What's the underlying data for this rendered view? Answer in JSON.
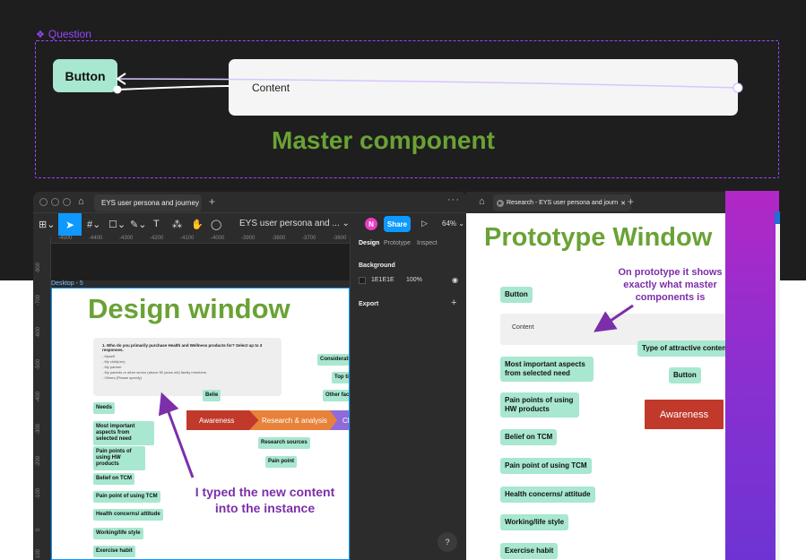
{
  "master": {
    "question_label": "Question",
    "button_label": "Button",
    "content_label": "Content",
    "title": "Master component"
  },
  "design_window": {
    "tab_title": "EYS user persona and journey",
    "file_name": "EYS user persona and ...",
    "avatar_initial": "N",
    "share_label": "Share",
    "zoom": "64%",
    "ruler_ticks": [
      "-4500",
      "-4400",
      "-4300",
      "-4200",
      "-4100",
      "-4000",
      "-3900",
      "-3800",
      "-3700",
      "-3600"
    ],
    "ruler_vticks": [
      "-800",
      "-700",
      "-600",
      "-500",
      "-400",
      "-300",
      "-200",
      "-100",
      "0",
      "100"
    ],
    "frame_label": "Desktop - 5",
    "title": "Design window",
    "question_card": {
      "title": "1. Who do you primarily purchase Health and Wellness products for? Select up to 3 responses.",
      "options": [
        "- Myself",
        "- My child(ren)",
        "- My partner",
        "- My parents or other senior (above 50 years old) family members",
        "- Others (Please specify)"
      ]
    },
    "chips_left": [
      "Needs",
      "Most important aspects from selected need",
      "Pain points of using HW products",
      "Belief on TCM",
      "Pain point of using TCM",
      "Health concerns/ attitude",
      "Working/life style",
      "Exercise habit"
    ],
    "chips_right": [
      "Consideration",
      "Top tier",
      "Other facto",
      "Belie"
    ],
    "journey": [
      "Awareness",
      "Research & analysis",
      "Cho"
    ],
    "chip_research_sources": "Research sources",
    "chip_pain_point": "Pain point",
    "annotation": "I typed the new content into the instance",
    "panel": {
      "tabs": [
        "Design",
        "Prototype",
        "Inspect"
      ],
      "background_heading": "Background",
      "bg_hex": "1E1E1E",
      "bg_opacity": "100%",
      "export_heading": "Export"
    }
  },
  "prototype_window": {
    "tab_title": "Research - EYS user persona and journ",
    "title": "Prototype Window",
    "annotation": "On prototype it shows exactly what master components is",
    "button_label": "Button",
    "content_label": "Content",
    "chips": [
      "Most important aspects from selected need",
      "Pain points of using HW products",
      "Belief on TCM",
      "Pain point of using TCM",
      "Health concerns/ attitude",
      "Working/life style",
      "Exercise habit"
    ],
    "chip_attractive": "Type of attractive conten",
    "button_right": "Button",
    "awareness": "Awareness"
  },
  "colors": {
    "accent_green": "#6aa235",
    "annotation_purple": "#7b2fa8",
    "component_purple": "#9747ff",
    "chip_mint": "#a8e7d0",
    "figma_blue": "#0d99ff",
    "awareness_red": "#c0392b"
  },
  "icons": [
    "component-icon",
    "home-icon",
    "figma-file-icon",
    "close-icon",
    "plus-icon",
    "more-icon",
    "main-menu-icon",
    "move-tool-icon",
    "frame-tool-icon",
    "shape-tool-icon",
    "pen-tool-icon",
    "text-tool-icon",
    "resources-icon",
    "hand-tool-icon",
    "comment-icon",
    "chevron-down-icon",
    "play-icon",
    "eye-icon",
    "help-icon"
  ]
}
